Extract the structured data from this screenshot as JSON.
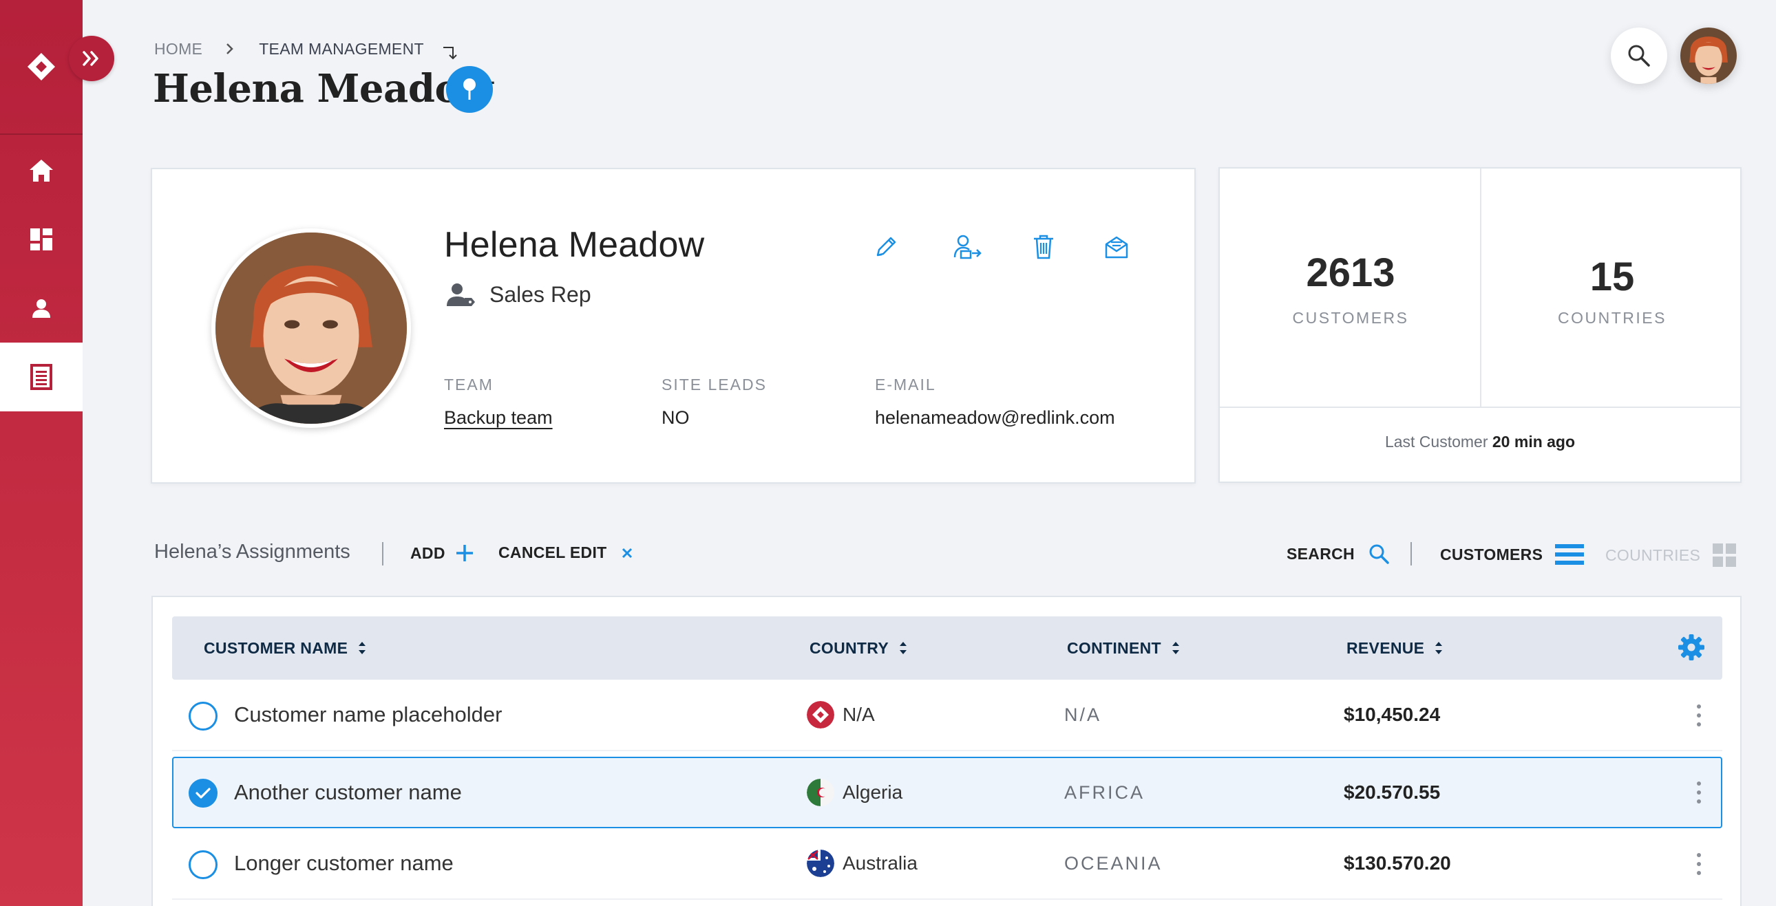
{
  "colors": {
    "brand_red": "#b5203a",
    "accent_blue": "#1a8fe3",
    "background": "#f1f3f7"
  },
  "sidebar": {
    "logo_icon": "brand-logo-icon",
    "toggle_icon": "double-chevron-right-icon",
    "items": [
      {
        "name": "home",
        "icon": "home-icon",
        "active": false
      },
      {
        "name": "dashboard",
        "icon": "dashboard-icon",
        "active": false
      },
      {
        "name": "users",
        "icon": "user-icon",
        "active": false
      },
      {
        "name": "list",
        "icon": "list-document-icon",
        "active": true
      }
    ]
  },
  "header": {
    "breadcrumb": {
      "home": "HOME",
      "current": "TEAM MANAGEMENT"
    },
    "title": "Helena Meadow"
  },
  "profile": {
    "name": "Helena Meadow",
    "role": "Sales Rep",
    "fields": {
      "team_label": "TEAM",
      "team_value": "Backup team",
      "site_leads_label": "SITE LEADS",
      "site_leads_value": "NO",
      "email_label": "E-MAIL",
      "email_value": "helenameadow@redlink.com"
    },
    "actions": [
      "edit-icon",
      "reassign-user-icon",
      "delete-icon",
      "mail-icon"
    ]
  },
  "stats": {
    "customers_value": "2613",
    "customers_label": "CUSTOMERS",
    "countries_value": "15",
    "countries_label": "COUNTRIES",
    "last_customer_label": "Last Customer",
    "last_customer_value": "20 min ago"
  },
  "assignments": {
    "title": "Helena’s Assignments",
    "add_label": "ADD",
    "cancel_label": "CANCEL EDIT",
    "search_label": "SEARCH",
    "customers_view_label": "CUSTOMERS",
    "countries_view_label": "COUNTRIES"
  },
  "table": {
    "columns": [
      "CUSTOMER NAME",
      "COUNTRY",
      "CONTINENT",
      "REVENUE"
    ],
    "rows": [
      {
        "name": "Customer name placeholder",
        "country": "N/A",
        "flag": "brand-logo-flag",
        "continent": "N/A",
        "revenue": "$10,450.24",
        "selected": false
      },
      {
        "name": "Another customer name",
        "country": "Algeria",
        "flag": "algeria-flag",
        "continent": "AFRICA",
        "revenue": "$20.570.55",
        "selected": true
      },
      {
        "name": "Longer customer name",
        "country": "Australia",
        "flag": "australia-flag",
        "continent": "OCEANIA",
        "revenue": "$130.570.20",
        "selected": false
      }
    ]
  }
}
